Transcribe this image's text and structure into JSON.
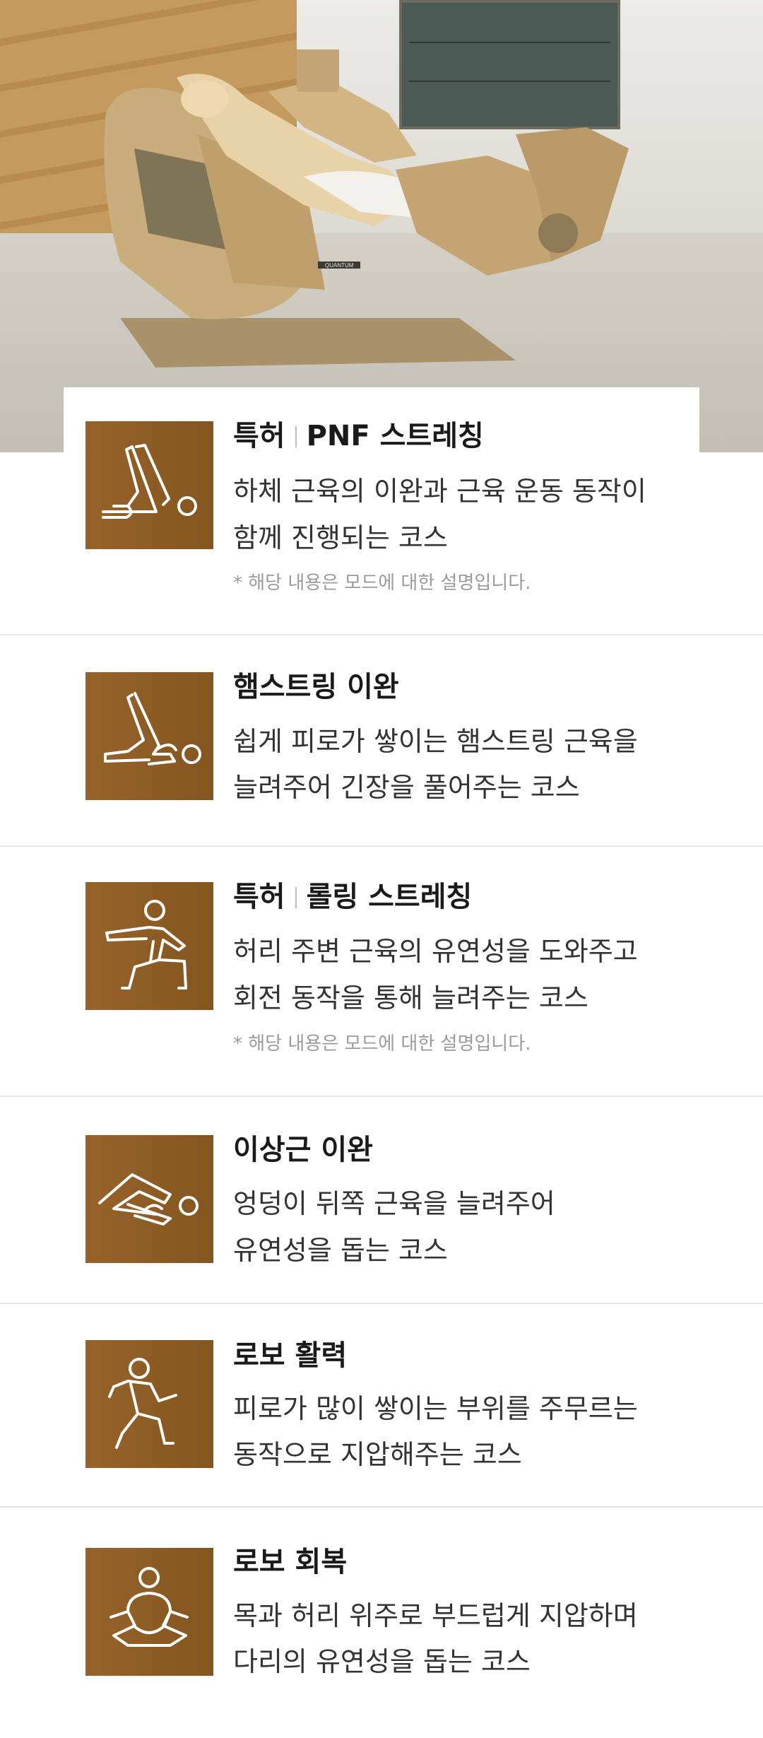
{
  "hero": {
    "brand_text": "QUANTUM"
  },
  "items": [
    {
      "badge": "특허",
      "title": "PNF 스트레칭",
      "desc1": "하체 근육의 이완과 근육 운동 동작이",
      "desc2": "함께 진행되는 코스",
      "note": "* 해당 내용은 모드에 대한 설명입니다.",
      "icon": "leg-stretch-icon"
    },
    {
      "badge": "",
      "title": "햄스트링 이완",
      "desc1": "쉽게 피로가 쌓이는 햄스트링 근육을",
      "desc2": "늘려주어 긴장을 풀어주는 코스",
      "note": "",
      "icon": "hamstring-stretch-icon"
    },
    {
      "badge": "특허",
      "title": "롤링 스트레칭",
      "desc1": "허리 주변 근육의 유연성을 도와주고",
      "desc2": "회전 동작을 통해 늘려주는 코스",
      "note": "* 해당 내용은 모드에 대한 설명입니다.",
      "icon": "lunge-stretch-icon"
    },
    {
      "badge": "",
      "title": "이상근 이완",
      "desc1": "엉덩이 뒤쪽 근육을 늘려주어",
      "desc2": "유연성을 돕는 코스",
      "note": "",
      "icon": "piriformis-stretch-icon"
    },
    {
      "badge": "",
      "title": "로보 활력",
      "desc1": "피로가 많이 쌓이는 부위를 주무르는",
      "desc2": "동작으로 지압해주는 코스",
      "note": "",
      "icon": "running-figure-icon"
    },
    {
      "badge": "",
      "title": "로보 회복",
      "desc1": "목과 허리 위주로 부드럽게 지압하며",
      "desc2": "다리의 유연성을 돕는 코스",
      "note": "",
      "icon": "meditation-figure-icon"
    }
  ],
  "colors": {
    "tile": "#8b5a23",
    "title": "#1a1a1a",
    "desc": "#333333",
    "note": "#9a9a9a"
  }
}
